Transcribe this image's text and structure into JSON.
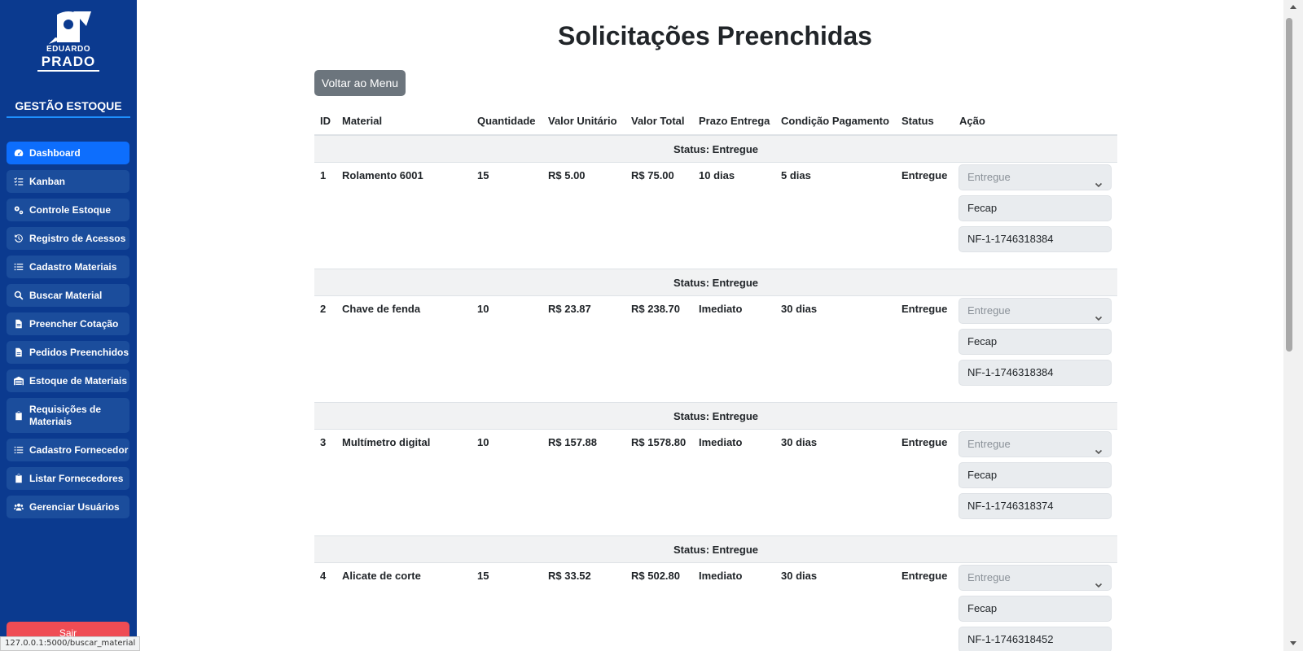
{
  "sidebar": {
    "logo_line1": "EDUARDO",
    "logo_line2": "PRADO",
    "brand_title": "GESTÃO ESTOQUE",
    "items": [
      {
        "label": "Dashboard",
        "icon": "gauge-icon"
      },
      {
        "label": "Kanban",
        "icon": "list-check-icon"
      },
      {
        "label": "Controle Estoque",
        "icon": "gears-icon"
      },
      {
        "label": "Registro de Acessos",
        "icon": "history-icon"
      },
      {
        "label": "Cadastro Materiais",
        "icon": "list-icon"
      },
      {
        "label": "Buscar Material",
        "icon": "search-icon"
      },
      {
        "label": "Preencher Cotação",
        "icon": "file-icon"
      },
      {
        "label": "Pedidos Preenchidos",
        "icon": "file-icon"
      },
      {
        "label": "Estoque de Materiais",
        "icon": "warehouse-icon"
      },
      {
        "label": "Requisições de Materiais",
        "icon": "clipboard-icon"
      },
      {
        "label": "Cadastro Fornecedor",
        "icon": "list-icon"
      },
      {
        "label": "Listar Fornecedores",
        "icon": "clipboard-icon"
      },
      {
        "label": "Gerenciar Usuários",
        "icon": "users-icon"
      }
    ],
    "logout_label": "Sair",
    "status_url": "127.0.0.1:5000/buscar_material",
    "colors": {
      "bg": "#0b3a8f",
      "active": "#0d6efd",
      "item": "#1b4d9c",
      "logout": "#ef4c54"
    }
  },
  "main": {
    "title": "Solicitações Preenchidas",
    "back_label": "Voltar ao Menu",
    "columns": [
      "ID",
      "Material",
      "Quantidade",
      "Valor Unitário",
      "Valor Total",
      "Prazo Entrega",
      "Condição Pagamento",
      "Status",
      "Ação"
    ],
    "rows": [
      {
        "group": "Status: Entregue",
        "id": "1",
        "material": "Rolamento 6001",
        "qty": "15",
        "unit": "R$ 5.00",
        "total": "R$ 75.00",
        "prazo": "10 dias",
        "cond": "5 dias",
        "status": "Entregue",
        "select": "Entregue",
        "supplier": "Fecap",
        "nf": "NF-1-1746318384"
      },
      {
        "group": "Status: Entregue",
        "id": "2",
        "material": "Chave de fenda",
        "qty": "10",
        "unit": "R$ 23.87",
        "total": "R$ 238.70",
        "prazo": "Imediato",
        "cond": "30 dias",
        "status": "Entregue",
        "select": "Entregue",
        "supplier": "Fecap",
        "nf": "NF-1-1746318384"
      },
      {
        "group": "Status: Entregue",
        "id": "3",
        "material": "Multímetro digital",
        "qty": "10",
        "unit": "R$ 157.88",
        "total": "R$ 1578.80",
        "prazo": "Imediato",
        "cond": "30 dias",
        "status": "Entregue",
        "select": "Entregue",
        "supplier": "Fecap",
        "nf": "NF-1-1746318374"
      },
      {
        "group": "Status: Entregue",
        "id": "4",
        "material": "Alicate de corte",
        "qty": "15",
        "unit": "R$ 33.52",
        "total": "R$ 502.80",
        "prazo": "Imediato",
        "cond": "30 dias",
        "status": "Entregue",
        "select": "Entregue",
        "supplier": "Fecap",
        "nf": "NF-1-1746318452"
      }
    ]
  }
}
